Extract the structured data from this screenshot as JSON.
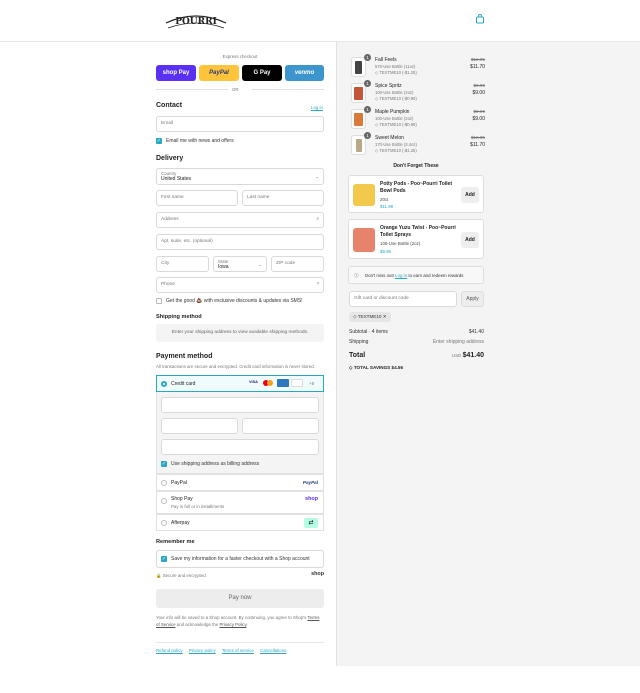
{
  "header": {
    "logo_text": "POURRI"
  },
  "express": {
    "label": "Express checkout",
    "buttons": [
      "shop Pay",
      "PayPal",
      "G Pay",
      "venmo"
    ],
    "or": "OR"
  },
  "contact": {
    "title": "Contact",
    "login": "Log in",
    "email_placeholder": "Email",
    "news_label": "Email me with news and offers"
  },
  "delivery": {
    "title": "Delivery",
    "country_label": "Country",
    "country_value": "United States",
    "first_name": "First name",
    "last_name": "Last name",
    "address": "Address",
    "apt": "Apt, suite, etc. (optional)",
    "city": "City",
    "state_label": "State",
    "state_value": "Iowa",
    "zip": "ZIP code",
    "phone": "Phone",
    "sms_label": "Get the good 💩 with exclusive discounts & updates via SMS!"
  },
  "shipping": {
    "title": "Shipping method",
    "placeholder": "Enter your shipping address to view available shipping methods."
  },
  "payment": {
    "title": "Payment method",
    "subtitle": "All transactions are secure and encrypted. Credit card information is never stored.",
    "credit_card": "Credit card",
    "cards": [
      "VISA",
      "MC",
      "AMEX",
      "DISC",
      "+5"
    ],
    "billing_label": "Use shipping address as billing address",
    "paypal": "PayPal",
    "paypal_brand": "PayPal",
    "shoppay": "Shop Pay",
    "shoppay_sub": "Pay in full or in installments",
    "shoppay_brand": "shop",
    "afterpay": "Afterpay"
  },
  "remember": {
    "title": "Remember me",
    "save_label": "Save my information for a faster checkout with a Shop account",
    "secure": "Secure and encrypted",
    "shop_brand": "shop"
  },
  "paynow": "Pay now",
  "legal": {
    "line1": "Your info will be saved to a Shop account. By continuing, you agree to Shop's",
    "terms": "Terms of Service",
    "and": "and acknowledge the",
    "privacy": "Privacy Policy",
    "end": "."
  },
  "footer_links": [
    "Refund policy",
    "Privacy policy",
    "Terms of service",
    "Cancellations"
  ],
  "cart": {
    "items": [
      {
        "name": "Fall Feels",
        "variant": "570-Use Bottle (11oz)",
        "discount": "TEXTME10 (-$1.25)",
        "old_price": "$12.95",
        "price": "$11.70",
        "qty": "1"
      },
      {
        "name": "Spice Spritz",
        "variant": "100-Use Bottle (2oz)",
        "discount": "TEXTME10 (-$0.99)",
        "old_price": "$9.99",
        "price": "$9.00",
        "qty": "1"
      },
      {
        "name": "Maple Pumpkin",
        "variant": "100-Use Bottle (2oz)",
        "discount": "TEXTME10 (-$0.99)",
        "old_price": "$9.99",
        "price": "$9.00",
        "qty": "1"
      },
      {
        "name": "Sweet Melon",
        "variant": "170-Use Bottle (3.4oz)",
        "discount": "TEXTME10 (-$1.25)",
        "old_price": "$12.95",
        "price": "$11.70",
        "qty": "1"
      }
    ],
    "upsell_title": "Don't Forget These",
    "upsells": [
      {
        "name": "Potty Pods - Poo~Pourri Toilet Bowl Pods",
        "variant": "20ct",
        "price": "$11.99",
        "button": "Add"
      },
      {
        "name": "Orange Yuzu Twist - Poo~Pourri Toilet Sprays",
        "variant": "100-Use Bottle (2oz)",
        "price": "$9.99",
        "button": "Add"
      }
    ],
    "rewards": "Don't miss out!",
    "rewards_link": "Log in",
    "rewards_end": "to earn and redeem rewards",
    "gift_placeholder": "Gift card or discount code",
    "apply": "Apply",
    "code_chip": "TEXTME10",
    "subtotal_label": "Subtotal · 4 items",
    "subtotal": "$41.40",
    "shipping_label": "Shipping",
    "shipping_value": "Enter shipping address",
    "total_label": "Total",
    "currency": "USD",
    "total": "$41.40",
    "savings_label": "TOTAL SAVINGS",
    "savings": "$4.56"
  },
  "colors": {
    "accent": "#2aa7c3",
    "shoppay": "#5a31f4",
    "paypal": "#ffc439",
    "gpay": "#000000",
    "venmo": "#3d95ce"
  }
}
